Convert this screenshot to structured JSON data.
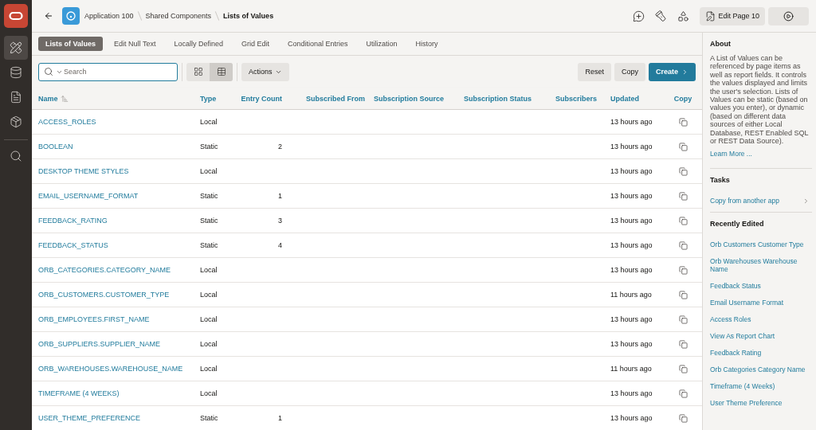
{
  "nav": [
    {
      "selected": true
    },
    {
      "selected": false
    },
    {
      "selected": false
    },
    {
      "selected": false
    },
    {
      "selected": false
    }
  ],
  "breadcrumb": [
    {
      "label": "Application 100",
      "current": false
    },
    {
      "label": "Shared Components",
      "current": false
    },
    {
      "label": "Lists of Values",
      "current": true
    }
  ],
  "edit_page_button": "Edit Page 10",
  "tabs": [
    {
      "label": "Lists of Values",
      "selected": true
    },
    {
      "label": "Edit Null Text",
      "selected": false
    },
    {
      "label": "Locally Defined",
      "selected": false
    },
    {
      "label": "Grid Edit",
      "selected": false
    },
    {
      "label": "Conditional Entries",
      "selected": false
    },
    {
      "label": "Utilization",
      "selected": false
    },
    {
      "label": "History",
      "selected": false
    }
  ],
  "search": {
    "placeholder": "Search"
  },
  "view_toggle": [
    {
      "selected": false
    },
    {
      "selected": true
    }
  ],
  "actions_button": "Actions",
  "buttons": [
    {
      "label": "Reset",
      "kind": "secondary"
    },
    {
      "label": "Copy",
      "kind": "secondary"
    },
    {
      "label": "Create",
      "kind": "primary"
    }
  ],
  "table": {
    "columns": [
      {
        "label": "Name",
        "kind": "link",
        "sorted": true
      },
      {
        "label": "Type",
        "kind": "text",
        "sorted": false
      },
      {
        "label": "Entry Count",
        "kind": "number",
        "sorted": false
      },
      {
        "label": "Subscribed From",
        "kind": "text",
        "sorted": false
      },
      {
        "label": "Subscription Source",
        "kind": "text",
        "sorted": false
      },
      {
        "label": "Subscription Status",
        "kind": "text",
        "sorted": false
      },
      {
        "label": "Subscribers",
        "kind": "number",
        "sorted": false
      },
      {
        "label": "Updated",
        "kind": "text",
        "sorted": false
      },
      {
        "label": "Copy",
        "kind": "action",
        "sorted": false
      }
    ],
    "rows": [
      {
        "name": "ACCESS_ROLES",
        "type": "Local",
        "updated": "13 hours ago"
      },
      {
        "name": "BOOLEAN",
        "type": "Static",
        "entry_count": "2",
        "updated": "13 hours ago"
      },
      {
        "name": "DESKTOP THEME STYLES",
        "type": "Local",
        "updated": "13 hours ago"
      },
      {
        "name": "EMAIL_USERNAME_FORMAT",
        "type": "Static",
        "entry_count": "1",
        "updated": "13 hours ago"
      },
      {
        "name": "FEEDBACK_RATING",
        "type": "Static",
        "entry_count": "3",
        "updated": "13 hours ago"
      },
      {
        "name": "FEEDBACK_STATUS",
        "type": "Static",
        "entry_count": "4",
        "updated": "13 hours ago"
      },
      {
        "name": "ORB_CATEGORIES.CATEGORY_NAME",
        "type": "Local",
        "updated": "13 hours ago"
      },
      {
        "name": "ORB_CUSTOMERS.CUSTOMER_TYPE",
        "type": "Local",
        "updated": "11 hours ago"
      },
      {
        "name": "ORB_EMPLOYEES.FIRST_NAME",
        "type": "Local",
        "updated": "13 hours ago"
      },
      {
        "name": "ORB_SUPPLIERS.SUPPLIER_NAME",
        "type": "Local",
        "updated": "13 hours ago"
      },
      {
        "name": "ORB_WAREHOUSES.WAREHOUSE_NAME",
        "type": "Local",
        "updated": "11 hours ago"
      },
      {
        "name": "TIMEFRAME (4 WEEKS)",
        "type": "Local",
        "updated": "13 hours ago"
      },
      {
        "name": "USER_THEME_PREFERENCE",
        "type": "Static",
        "entry_count": "1",
        "updated": "13 hours ago"
      }
    ]
  },
  "side_panel": {
    "about": {
      "heading": "About",
      "text": "A List of Values can be referenced by page items as well as report fields. It controls the values displayed and limits the user's selection. Lists of Values can be static (based on values you enter), or dynamic (based on different data sources of either Local Database, REST Enabled SQL or REST Data Source).",
      "link": "Learn More ..."
    },
    "tasks": {
      "heading": "Tasks",
      "items": [
        "Copy from another app"
      ]
    },
    "recently_edited": {
      "heading": "Recently Edited",
      "items": [
        "Orb Customers Customer Type",
        "Orb Warehouses Warehouse Name",
        "Feedback Status",
        "Email Username Format",
        "Access Roles",
        "View As Report Chart",
        "Feedback Rating",
        "Orb Categories Category Name",
        "Timeframe (4 Weeks)",
        "User Theme Preference"
      ]
    }
  }
}
